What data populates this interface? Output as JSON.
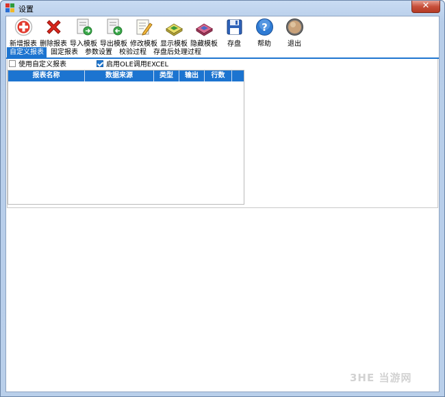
{
  "window": {
    "title": "设置",
    "close_symbol": "✕"
  },
  "toolbar": {
    "items": [
      {
        "label": "新增报表",
        "icon": "add-icon"
      },
      {
        "label": "删除报表",
        "icon": "delete-icon"
      },
      {
        "label": "导入模板",
        "icon": "import-icon"
      },
      {
        "label": "导出模板",
        "icon": "export-icon"
      },
      {
        "label": "修改模板",
        "icon": "edit-icon"
      },
      {
        "label": "显示模板",
        "icon": "show-icon"
      },
      {
        "label": "隐藏模板",
        "icon": "hide-icon"
      },
      {
        "label": "存盘",
        "icon": "save-icon"
      },
      {
        "label": "帮助",
        "icon": "help-icon"
      },
      {
        "label": "退出",
        "icon": "exit-icon"
      }
    ]
  },
  "tabs": [
    {
      "label": "自定义报表",
      "active": true
    },
    {
      "label": "固定报表",
      "active": false
    },
    {
      "label": "参数设置",
      "active": false
    },
    {
      "label": "校验过程",
      "active": false
    },
    {
      "label": "存盘后处理过程",
      "active": false
    }
  ],
  "options": {
    "use_custom_report": {
      "label": "使用自定义报表",
      "checked": false
    },
    "enable_ole_excel": {
      "label": "启用OLE调用EXCEL",
      "checked": true
    }
  },
  "grid": {
    "columns": [
      "报表名称",
      "数据来源",
      "类型",
      "输出",
      "行数"
    ],
    "rows": []
  },
  "watermark": "3HE 当游网",
  "colors": {
    "accent": "#1c74d0",
    "title_bar": "#c9dcf3"
  }
}
